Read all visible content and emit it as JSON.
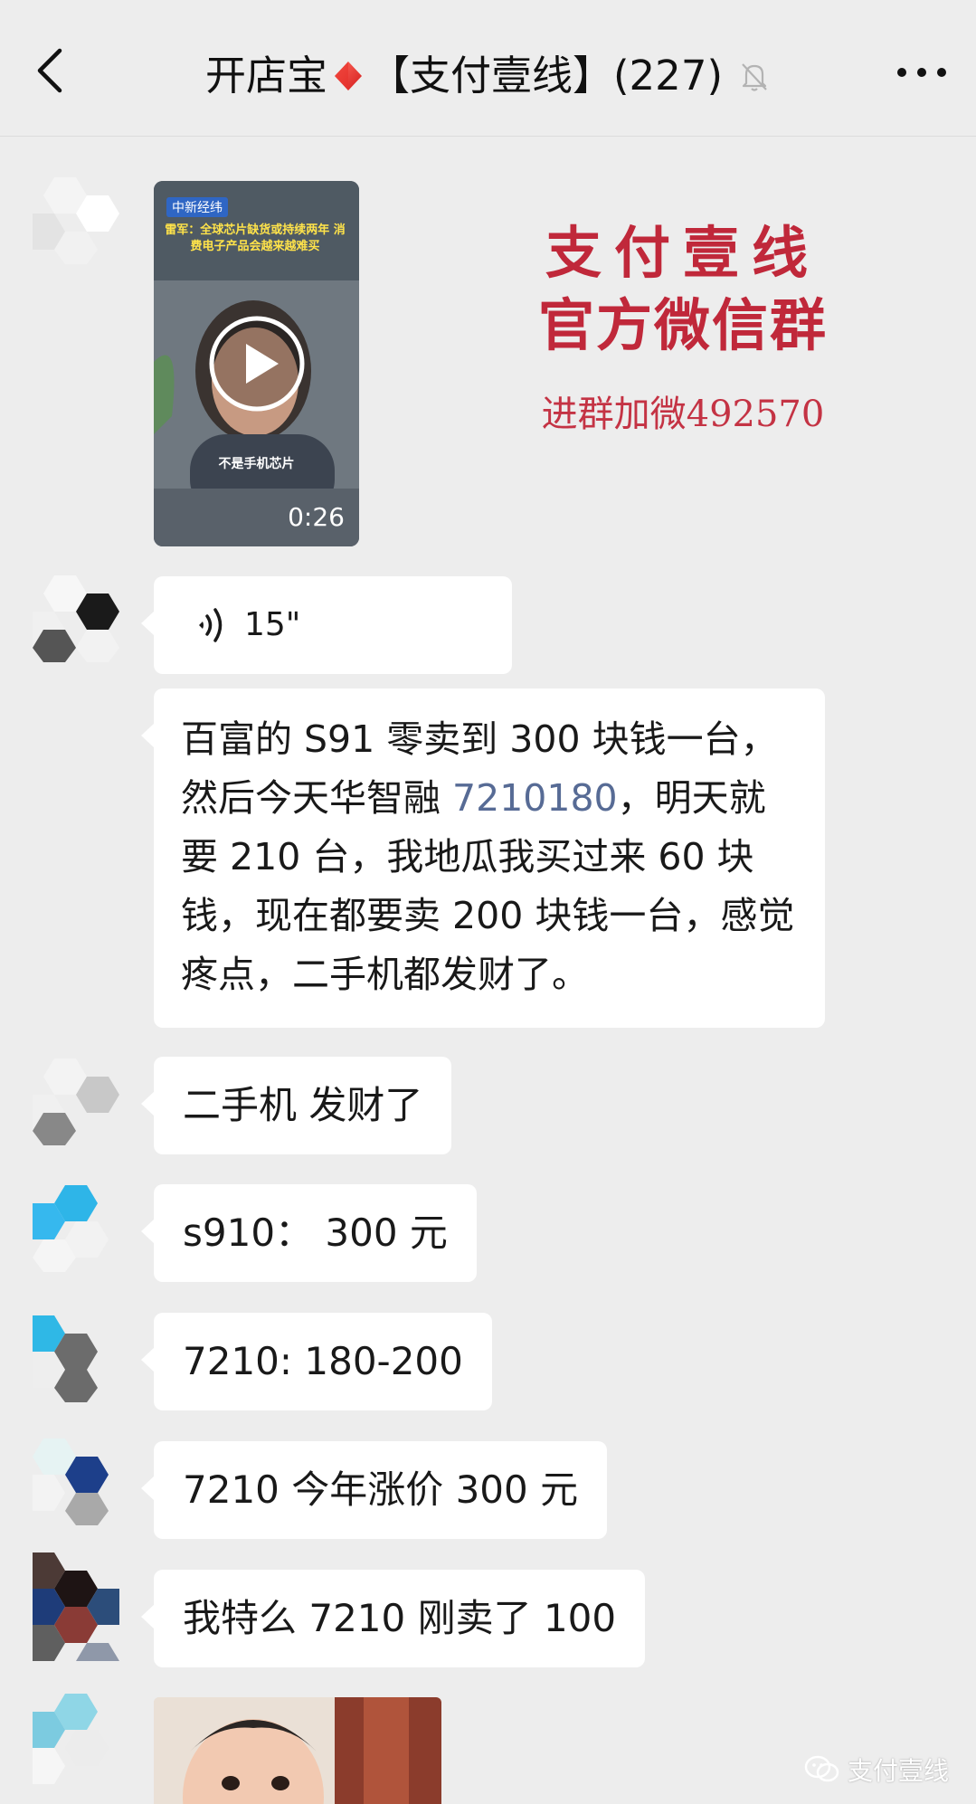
{
  "header": {
    "title_prefix": "开店宝",
    "title_group": "【支付壹线】(227)",
    "back_icon": "chevron-left-icon",
    "muted_icon": "bell-off-icon",
    "more_icon": "more-dots-icon"
  },
  "video": {
    "duration": "0:26",
    "source_badge": "中新经纬",
    "caption": "雷军：全球芯片缺货或持续两年 消费电子产品会越来越难买",
    "subtitle": "不是手机芯片"
  },
  "watermark": {
    "line1": "支付壹线",
    "line2": "官方微信群",
    "line3": "进群加微492570"
  },
  "voice": {
    "duration": "15\""
  },
  "messages": {
    "long_part1": "百富的 S91 零卖到 300 块钱一台，然后今天华智融 ",
    "long_link": "7210180",
    "long_part2": "，明天就要 210 台，我地瓜我买过来 60 块钱，现在都要卖 200 块钱一台，感觉疼点，二手机都发财了。",
    "m1": "二手机 发财了",
    "m2": "s910： 300 元",
    "m3": "7210: 180-200",
    "m4": "7210 今年涨价 300 元",
    "m5": "我特么 7210 刚卖了 100"
  },
  "footer": {
    "account": "支付壹线"
  },
  "colors": {
    "background": "#ededed",
    "bubble": "#ffffff",
    "link": "#576b95",
    "watermark": "#c0283a"
  }
}
